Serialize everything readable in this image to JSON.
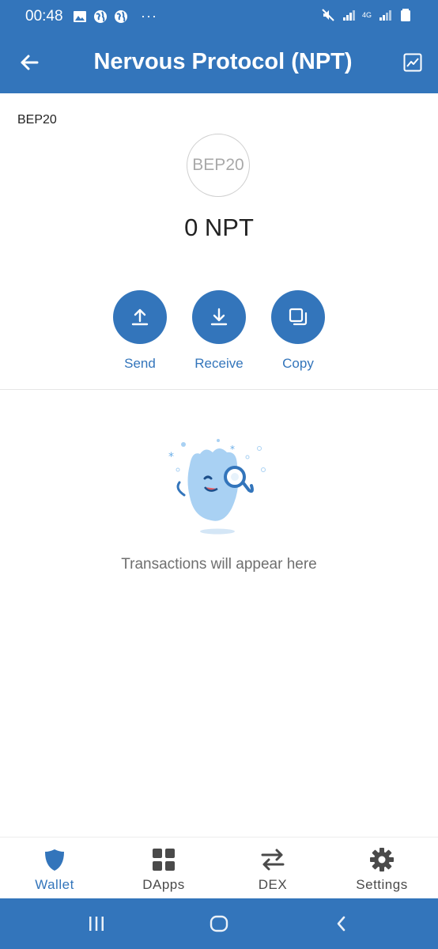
{
  "status_bar": {
    "time": "00:48",
    "network_label": "4G",
    "more_indicator": "···"
  },
  "header": {
    "title": "Nervous Protocol (NPT)",
    "back_icon": "arrow-left-icon",
    "chart_icon": "chart-icon"
  },
  "token": {
    "standard": "BEP20",
    "logo_text": "BEP20",
    "balance": "0 NPT"
  },
  "actions": [
    {
      "label": "Send",
      "icon": "upload-icon"
    },
    {
      "label": "Receive",
      "icon": "download-icon"
    },
    {
      "label": "Copy",
      "icon": "copy-icon"
    }
  ],
  "empty_state": {
    "message": "Transactions will appear here"
  },
  "bottom_nav": {
    "active": "Wallet",
    "items": [
      {
        "label": "Wallet",
        "icon": "shield-icon"
      },
      {
        "label": "DApps",
        "icon": "grid-icon"
      },
      {
        "label": "DEX",
        "icon": "swap-icon"
      },
      {
        "label": "Settings",
        "icon": "gear-icon"
      }
    ]
  },
  "colors": {
    "primary": "#3375bb",
    "text": "#222222",
    "muted": "#6f6f6f"
  }
}
